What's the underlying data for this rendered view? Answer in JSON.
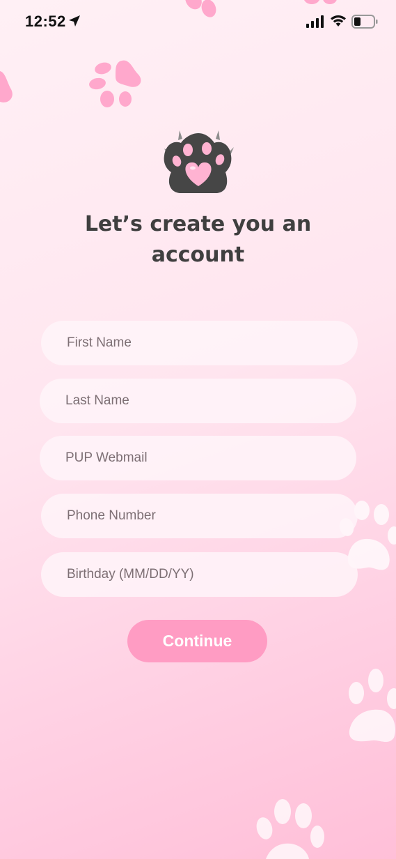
{
  "status_bar": {
    "time": "12:52",
    "location_icon": "location-arrow-icon",
    "signal_icon": "cellular-signal-icon",
    "wifi_icon": "wifi-icon",
    "battery_icon": "battery-low-icon"
  },
  "logo": {
    "icon": "paw-heart-logo"
  },
  "title": "Let’s create you an account",
  "form": {
    "first_name_placeholder": "First Name",
    "last_name_placeholder": "Last Name",
    "webmail_placeholder": "PUP Webmail",
    "phone_placeholder": "Phone Number",
    "birthday_placeholder": "Birthday (MM/DD/YY)",
    "continue_label": "Continue"
  },
  "colors": {
    "accent": "#ff9cc3",
    "paw_pink": "#ffa8cc",
    "title_text": "#3f3f3f"
  }
}
